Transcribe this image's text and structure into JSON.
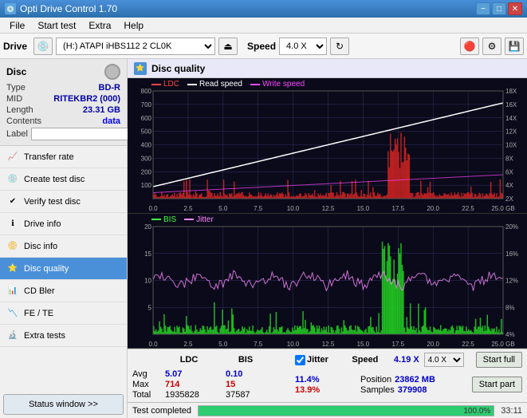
{
  "app": {
    "title": "Opti Drive Control 1.70",
    "icon": "💿"
  },
  "titlebar": {
    "minimize": "−",
    "maximize": "□",
    "close": "✕"
  },
  "menubar": {
    "items": [
      "File",
      "Start test",
      "Extra",
      "Help"
    ]
  },
  "toolbar": {
    "drive_label": "Drive",
    "drive_value": "(H:) ATAPI iHBS112  2 CL0K",
    "speed_label": "Speed",
    "speed_value": "4.0 X"
  },
  "disc": {
    "header": "Disc",
    "type_label": "Type",
    "type_value": "BD-R",
    "mid_label": "MID",
    "mid_value": "RITEKBR2 (000)",
    "length_label": "Length",
    "length_value": "23.31 GB",
    "contents_label": "Contents",
    "contents_value": "data",
    "label_label": "Label"
  },
  "nav": {
    "items": [
      {
        "id": "transfer-rate",
        "label": "Transfer rate",
        "icon": "📈"
      },
      {
        "id": "create-test-disc",
        "label": "Create test disc",
        "icon": "💿"
      },
      {
        "id": "verify-test-disc",
        "label": "Verify test disc",
        "icon": "✔"
      },
      {
        "id": "drive-info",
        "label": "Drive info",
        "icon": "ℹ"
      },
      {
        "id": "disc-info",
        "label": "Disc info",
        "icon": "📀"
      },
      {
        "id": "disc-quality",
        "label": "Disc quality",
        "icon": "⭐",
        "active": true
      },
      {
        "id": "cd-bler",
        "label": "CD Bler",
        "icon": "📊"
      },
      {
        "id": "fe-te",
        "label": "FE / TE",
        "icon": "📉"
      },
      {
        "id": "extra-tests",
        "label": "Extra tests",
        "icon": "🔬"
      }
    ],
    "status_btn": "Status window >>"
  },
  "quality_header": {
    "title": "Disc quality",
    "icon": "⭐"
  },
  "legend_top": {
    "items": [
      {
        "label": "LDC",
        "color": "#ff4444"
      },
      {
        "label": "Read speed",
        "color": "#ffffff"
      },
      {
        "label": "Write speed",
        "color": "#ff44ff"
      }
    ]
  },
  "legend_bottom": {
    "items": [
      {
        "label": "BIS",
        "color": "#44ff44"
      },
      {
        "label": "Jitter",
        "color": "#ff88ff"
      }
    ]
  },
  "chart_top": {
    "y_max": 800,
    "y_labels": [
      "800",
      "700",
      "600",
      "500",
      "400",
      "300",
      "200",
      "100"
    ],
    "y_right_labels": [
      "18X",
      "16X",
      "14X",
      "12X",
      "10X",
      "8X",
      "6X",
      "4X",
      "2X"
    ],
    "x_labels": [
      "0.0",
      "2.5",
      "5.0",
      "7.5",
      "10.0",
      "12.5",
      "15.0",
      "17.5",
      "20.0",
      "22.5",
      "25.0 GB"
    ]
  },
  "chart_bottom": {
    "y_max": 20,
    "y_labels": [
      "20",
      "15",
      "10",
      "5"
    ],
    "y_right_labels": [
      "20%",
      "16%",
      "12%",
      "8%",
      "4%"
    ],
    "x_labels": [
      "0.0",
      "2.5",
      "5.0",
      "7.5",
      "10.0",
      "12.5",
      "15.0",
      "17.5",
      "20.0",
      "22.5",
      "25.0 GB"
    ]
  },
  "stats": {
    "columns": [
      "LDC",
      "BIS",
      "",
      "Jitter",
      "Speed",
      ""
    ],
    "rows": {
      "avg": {
        "label": "Avg",
        "ldc": "5.07",
        "bis": "0.10",
        "jitter": "11.4%",
        "speed": "4.19 X",
        "speed_select": "4.0 X"
      },
      "max": {
        "label": "Max",
        "ldc": "714",
        "bis": "15",
        "jitter": "13.9%"
      },
      "total": {
        "label": "Total",
        "ldc": "1935828",
        "bis": "37587",
        "position": "23862 MB",
        "samples": "379908"
      }
    },
    "jitter_checked": true,
    "position_label": "Position",
    "samples_label": "Samples",
    "btn_full": "Start full",
    "btn_part": "Start part"
  },
  "bottom_bar": {
    "status": "Test completed",
    "progress": 100,
    "time": "33:11"
  }
}
